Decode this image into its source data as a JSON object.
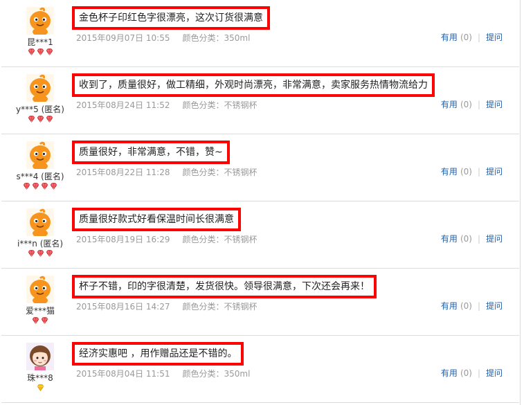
{
  "reviews": [
    {
      "user": "昆***1",
      "avatar_icon": "orange-mascot-avatar-icon",
      "level": 3,
      "level_icon": "red-heart-gem-icon",
      "content": "金色杯子印红色字很漂亮，这次订货很满意",
      "date": "2015年09月07日 10:55",
      "spec": "颜色分类：350ml",
      "useful_label": "有用",
      "useful_count": "(0)",
      "ask_label": "提问"
    },
    {
      "user": "y***5 (匿名)",
      "avatar_icon": "orange-mascot-avatar-icon",
      "level": 3,
      "level_icon": "red-heart-gem-icon",
      "content": "收到了，质量很好，做工精细，外观时尚漂亮，非常满意，卖家服务热情物流给力",
      "date": "2015年08月24日 11:52",
      "spec": "颜色分类：不锈钢杯",
      "useful_label": "有用",
      "useful_count": "(0)",
      "ask_label": "提问"
    },
    {
      "user": "s***4 (匿名)",
      "avatar_icon": "orange-mascot-avatar-icon",
      "level": 4,
      "level_icon": "red-heart-gem-icon",
      "content": "质量很好，非常满意，不错，赞~",
      "date": "2015年08月22日 11:28",
      "spec": "颜色分类：不锈钢杯",
      "useful_label": "有用",
      "useful_count": "(0)",
      "ask_label": "提问"
    },
    {
      "user": "i***n (匿名)",
      "avatar_icon": "orange-mascot-avatar-icon",
      "level": 3,
      "level_icon": "red-heart-gem-icon",
      "content": "质量很好款式好看保温时间长很满意",
      "date": "2015年08月19日 16:29",
      "spec": "颜色分类：不锈钢杯",
      "useful_label": "有用",
      "useful_count": "(0)",
      "ask_label": "提问"
    },
    {
      "user": "爱***猫",
      "avatar_icon": "orange-mascot-avatar-icon",
      "level": 2,
      "level_icon": "red-heart-gem-icon",
      "content": "杯子不错，印的字很清楚，发货很快。领导很满意，下次还会再来！",
      "date": "2015年08月16日 14:27",
      "spec": "颜色分类：不锈钢杯",
      "useful_label": "有用",
      "useful_count": "(0)",
      "ask_label": "提问"
    },
    {
      "user": "珠***8",
      "avatar_icon": "cartoon-girl-avatar-icon",
      "level": 1,
      "level_icon": "yellow-diamond-icon",
      "content": "经济实惠吧 ，用作赠品还是不错的。",
      "date": "2015年08月04日 11:51",
      "spec": "颜色分类：350ml",
      "useful_label": "有用",
      "useful_count": "(0)",
      "ask_label": "提问"
    }
  ],
  "colors": {
    "highlight_border": "#ff0000",
    "link": "#1f5fa8",
    "meta_text": "#999999",
    "mascot_orange": "#f7941d",
    "gem_red": "#e8383d",
    "diamond_yellow": "#f5b800"
  }
}
